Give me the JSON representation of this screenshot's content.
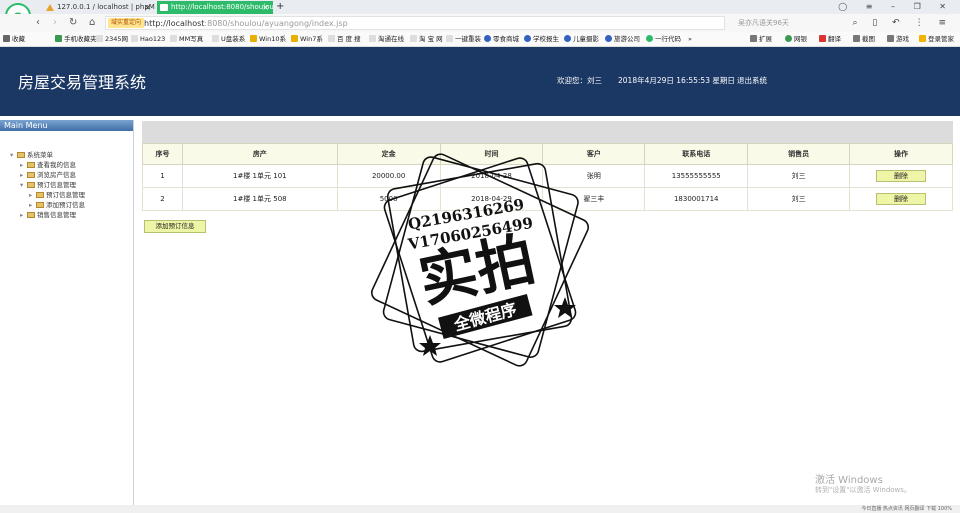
{
  "browser": {
    "tabs": [
      {
        "label": "127.0.0.1 / localhost | phpMy"
      },
      {
        "label": "http://localhost:8080/shoulou"
      }
    ],
    "compat_tag": "域实重定向",
    "url_host": "http://localhost",
    "url_rest": ":8080/shoulou/ayuangong/index.jsp",
    "search_placeholder": "吴亦凡语关96天",
    "bookmarks": [
      "收藏",
      "手机收藏夹",
      "2345网",
      "Hao123",
      "MM写真",
      "U盘装系",
      "Win10系",
      "Win7系",
      "百 度 搜",
      "淘通在线",
      "淘 宝 网",
      "一键重装",
      "零食商城",
      "学校报生",
      "儿童摄影",
      "旅游公司",
      "一行代码",
      "»",
      "扩展",
      "网银",
      "翻译",
      "截图",
      "游戏",
      "登录管家"
    ]
  },
  "header": {
    "title": "房屋交易管理系统",
    "welcome": "欢迎您：刘三",
    "datetime": "2018年4月29日 16:55:53 星期日",
    "logout": "退出系统"
  },
  "sidebar": {
    "menu_title": "Main Menu",
    "root": "系统菜单",
    "items": [
      "查看我的信息",
      "浏览房产信息",
      "预订信息管理",
      "预订信息管理",
      "添加预订信息",
      "销售信息管理"
    ]
  },
  "table": {
    "headers": [
      "序号",
      "房产",
      "定金",
      "时间",
      "客户",
      "联系电话",
      "销售员",
      "操作"
    ],
    "rows": [
      {
        "no": "1",
        "house": "1#楼   1单元   101",
        "deposit": "20000.00",
        "date": "2018-04-28",
        "customer": "张明",
        "phone": "13555555555",
        "seller": "刘三",
        "action": "删除"
      },
      {
        "no": "2",
        "house": "1#楼   1单元   508",
        "deposit": "5000",
        "date": "2018-04-29",
        "customer": "翟三丰",
        "phone": "1830001714",
        "seller": "刘三",
        "action": "删除"
      }
    ],
    "add_button": "添加预订信息"
  },
  "stamp": {
    "line1": "Q2196316269",
    "line2": "V17060256499",
    "big": "实拍",
    "sub": "全微程序"
  },
  "watermark": {
    "line1": "激活 Windows",
    "line2": "转到\"设置\"以激活 Windows。"
  },
  "status": {
    "text": "今日直播  热点资讯  网页翻译  下载  100%"
  }
}
